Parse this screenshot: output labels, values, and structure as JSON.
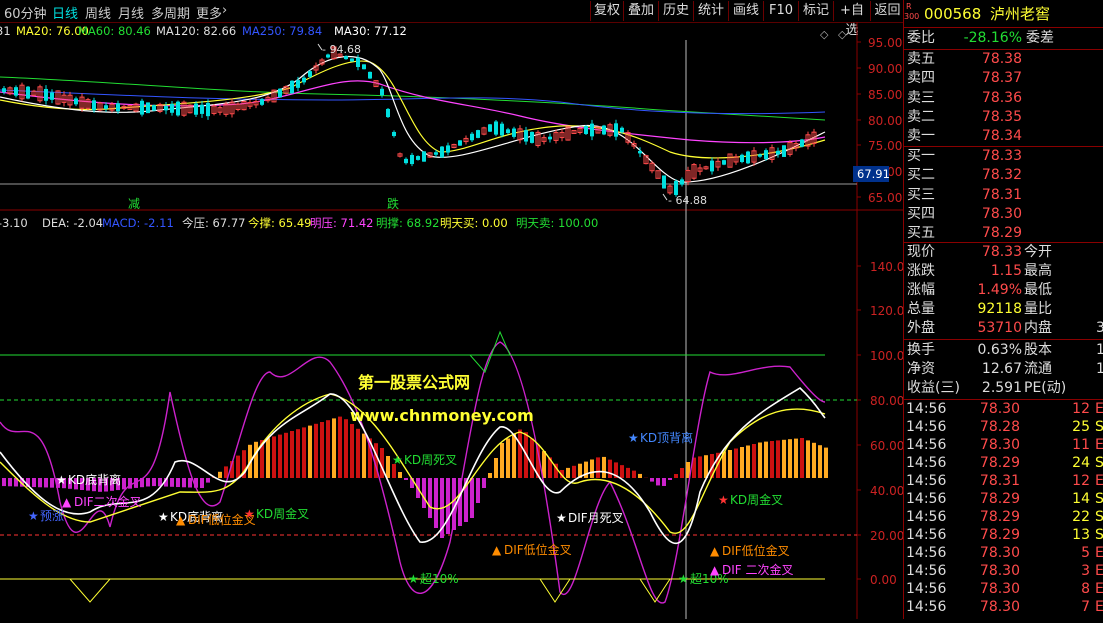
{
  "toolbar": {
    "left_tabs": [
      "60分钟",
      "日线",
      "周线",
      "月线",
      "多周期",
      "更多"
    ],
    "active_tab": "日线",
    "buttons": [
      "复权",
      "叠加",
      "历史",
      "统计",
      "画线",
      "F10",
      "标记",
      "+自选",
      "返回"
    ]
  },
  "stock": {
    "code": "000568",
    "name": "泸州老窖",
    "market_badge": "R",
    "market_num": "300"
  },
  "price_chart": {
    "ma_labels": [
      {
        "text": "31",
        "color": "#dddddd"
      },
      {
        "text": "MA20: 76.00",
        "color": "#ffff33"
      },
      {
        "text": "MA60: 80.46",
        "color": "#22dd33"
      },
      {
        "text": "MA120: 82.66",
        "color": "#dddddd"
      },
      {
        "text": "MA250: 79.84",
        "color": "#3355ff"
      },
      {
        "text": "MA30: 77.12",
        "color": "#ffffff"
      }
    ],
    "y_ticks": [
      "95.00",
      "90.00",
      "85.00",
      "80.00",
      "75.00",
      "70.00",
      "65.00"
    ],
    "high_label": "94.68",
    "low_label": "64.88",
    "price_marker": "67.91",
    "markers": [
      {
        "text": "减"
      },
      {
        "text": "跌"
      }
    ]
  },
  "indicator_chart": {
    "labels": [
      {
        "text": ":-3.10",
        "color": "#dddddd"
      },
      {
        "text": "DEA: -2.04",
        "color": "#dddddd"
      },
      {
        "text": "MACD: -2.11",
        "color": "#3355ff"
      },
      {
        "text": "今压: 67.77",
        "color": "#dddddd"
      },
      {
        "text": "今撑: 65.49",
        "color": "#ffff33"
      },
      {
        "text": "明压: 71.42",
        "color": "#ff44ff"
      },
      {
        "text": "明撑: 68.92",
        "color": "#22dd33"
      },
      {
        "text": "明天买: 0.00",
        "color": "#ffff33"
      },
      {
        "text": "明天卖: 100.00",
        "color": "#22dd33"
      }
    ],
    "y_ticks": [
      "140.00",
      "120.00",
      "100.00",
      "80.00",
      "60.00",
      "40.00",
      "20.00",
      "0.00"
    ],
    "watermark_1": "第一股票公式网",
    "watermark_2": "www.chnmoney.com",
    "annotations": [
      {
        "text": "KD底背离",
        "color": "#ffffff"
      },
      {
        "text": "DIF二次金叉",
        "color": "#ff44ff"
      },
      {
        "text": "预涨",
        "color": "#4466ff"
      },
      {
        "text": "KD底背离",
        "color": "#ffffff"
      },
      {
        "text": "DIF低位金叉",
        "color": "#ff8c00"
      },
      {
        "text": "KD周金叉",
        "color": "#22dd33"
      },
      {
        "text": "KD周死叉",
        "color": "#22dd33"
      },
      {
        "text": "DIF月死叉",
        "color": "#ffffff"
      },
      {
        "text": "KD顶背离",
        "color": "#4488ff"
      },
      {
        "text": "DIF低位金叉",
        "color": "#ff8c00"
      },
      {
        "text": "超10%",
        "color": "#22dd33"
      },
      {
        "text": "超10%",
        "color": "#22dd33"
      },
      {
        "text": "KD周金叉",
        "color": "#22dd33"
      },
      {
        "text": "DIF低位金叉",
        "color": "#ff8c00"
      },
      {
        "text": "DIF 二次金叉",
        "color": "#ff44ff"
      }
    ]
  },
  "quote": {
    "weibi_label": "委比",
    "weibi_value": "-28.16%",
    "weicha_label": "委差",
    "asks": [
      {
        "label": "卖五",
        "price": "78.38"
      },
      {
        "label": "卖四",
        "price": "78.37"
      },
      {
        "label": "卖三",
        "price": "78.36"
      },
      {
        "label": "卖二",
        "price": "78.35"
      },
      {
        "label": "卖一",
        "price": "78.34"
      }
    ],
    "bids": [
      {
        "label": "买一",
        "price": "78.33"
      },
      {
        "label": "买二",
        "price": "78.32"
      },
      {
        "label": "买三",
        "price": "78.31"
      },
      {
        "label": "买四",
        "price": "78.30"
      },
      {
        "label": "买五",
        "price": "78.29"
      }
    ],
    "stats": [
      {
        "label": "现价",
        "value": "78.33",
        "value_color": "#ff4b4b",
        "label2": "今开",
        "value2": ""
      },
      {
        "label": "涨跌",
        "value": "1.15",
        "value_color": "#ff4b4b",
        "label2": "最高",
        "value2": ""
      },
      {
        "label": "涨幅",
        "value": "1.49%",
        "value_color": "#ff4b4b",
        "label2": "最低",
        "value2": ""
      },
      {
        "label": "总量",
        "value": "92118",
        "value_color": "#ffff33",
        "label2": "量比",
        "value2": ""
      },
      {
        "label": "外盘",
        "value": "53710",
        "value_color": "#ff4b4b",
        "label2": "内盘",
        "value2": "3"
      }
    ],
    "fund": [
      {
        "label": "换手",
        "value": "0.63%",
        "label2": "股本",
        "value2": "1"
      },
      {
        "label": "净资",
        "value": "12.67",
        "label2": "流通",
        "value2": "1"
      },
      {
        "label": "收益(三)",
        "value": "2.591",
        "label2": "PE(动)",
        "value2": ""
      }
    ],
    "ticks": [
      {
        "time": "14:56",
        "price": "78.30",
        "vol": "12",
        "flag": "E"
      },
      {
        "time": "14:56",
        "price": "78.28",
        "vol": "25",
        "flag": "S"
      },
      {
        "time": "14:56",
        "price": "78.30",
        "vol": "11",
        "flag": "E"
      },
      {
        "time": "14:56",
        "price": "78.29",
        "vol": "24",
        "flag": "S"
      },
      {
        "time": "14:56",
        "price": "78.31",
        "vol": "12",
        "flag": "E"
      },
      {
        "time": "14:56",
        "price": "78.29",
        "vol": "14",
        "flag": "S"
      },
      {
        "time": "14:56",
        "price": "78.29",
        "vol": "22",
        "flag": "S"
      },
      {
        "time": "14:56",
        "price": "78.29",
        "vol": "13",
        "flag": "S"
      },
      {
        "time": "14:56",
        "price": "78.30",
        "vol": "5",
        "flag": "E"
      },
      {
        "time": "14:56",
        "price": "78.30",
        "vol": "3",
        "flag": "E"
      },
      {
        "time": "14:56",
        "price": "78.30",
        "vol": "8",
        "flag": "E"
      },
      {
        "time": "14:56",
        "price": "78.30",
        "vol": "7",
        "flag": "E"
      }
    ]
  },
  "colors": {
    "up": "#ff4b4b",
    "down": "#22dd33",
    "grid": "#8a0000",
    "accent": "#ffff33"
  }
}
